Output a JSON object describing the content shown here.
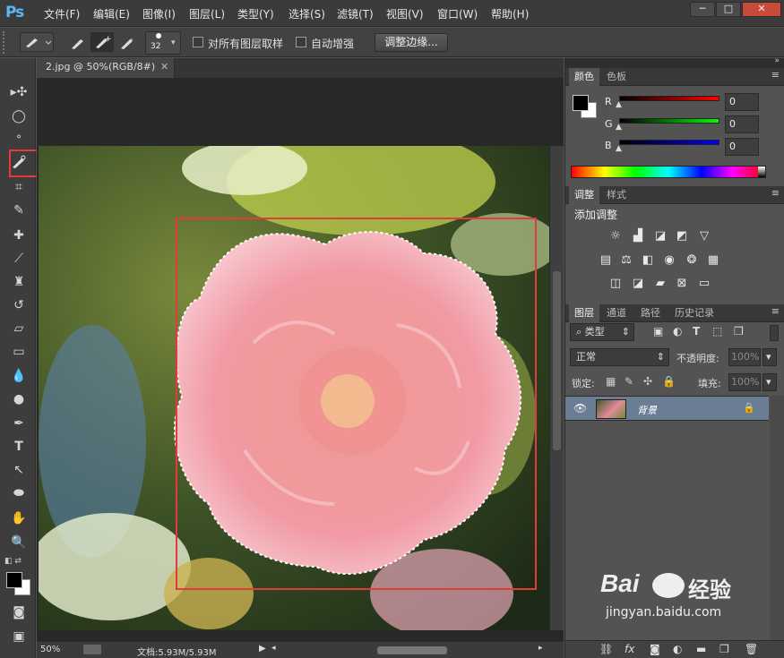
{
  "app": {
    "logo": "Ps"
  },
  "menu": [
    "文件(F)",
    "编辑(E)",
    "图像(I)",
    "图层(L)",
    "类型(Y)",
    "选择(S)",
    "滤镜(T)",
    "视图(V)",
    "窗口(W)",
    "帮助(H)"
  ],
  "window_controls": {
    "minimize": "─",
    "restore": "□",
    "close": "✕"
  },
  "options": {
    "brush_size": "32",
    "sample_all_layers_label": "对所有图层取样",
    "auto_enhance_label": "自动增强",
    "refine_edge_label": "调整边缘..."
  },
  "document": {
    "tab_title": "2.jpg @ 50%(RGB/8#)",
    "zoom": "50%",
    "doc_info": "文档:5.93M/5.93M"
  },
  "color_panel": {
    "tabs": [
      "颜色",
      "色板"
    ],
    "channels": [
      {
        "label": "R",
        "value": "0"
      },
      {
        "label": "G",
        "value": "0"
      },
      {
        "label": "B",
        "value": "0"
      }
    ],
    "foreground": "#000000",
    "background": "#ffffff"
  },
  "adjust_panel": {
    "tabs": [
      "调整",
      "样式"
    ],
    "heading": "添加调整"
  },
  "layers_panel": {
    "tabs": [
      "图层",
      "通道",
      "路径",
      "历史记录"
    ],
    "filter_label": "类型",
    "blend_mode": "正常",
    "opacity_label": "不透明度:",
    "opacity_value": "100%",
    "lock_label": "锁定:",
    "fill_label": "填充:",
    "fill_value": "100%",
    "layers": [
      {
        "name": "背景",
        "locked": true,
        "visible": true
      }
    ]
  },
  "watermark": {
    "brand": "Bai",
    "brand2": "经验",
    "url": "jingyan.baidu.com"
  }
}
